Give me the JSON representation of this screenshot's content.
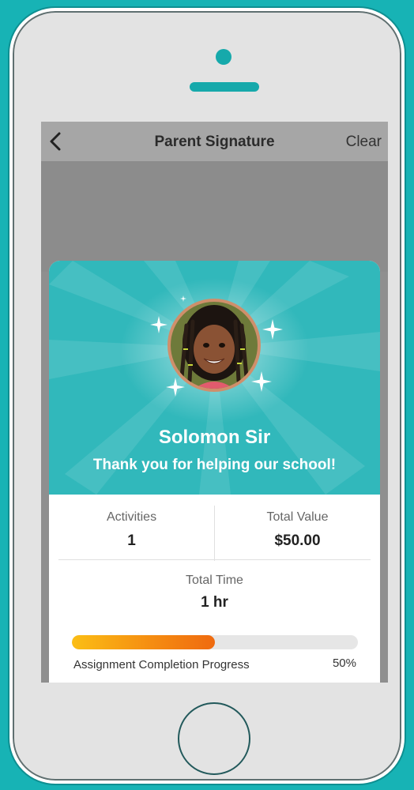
{
  "nav": {
    "title": "Parent Signature",
    "clear_label": "Clear",
    "back_icon": "chevron-left-icon"
  },
  "profile": {
    "name": "Solomon Sir",
    "message": "Thank you for helping our school!"
  },
  "stats": {
    "activities_label": "Activities",
    "activities_value": "1",
    "total_value_label": "Total Value",
    "total_value_value": "$50.00",
    "total_time_label": "Total Time",
    "total_time_value": "1 hr"
  },
  "progress": {
    "label": "Assignment Completion Progress",
    "percent_text": "50%",
    "fraction": 0.5
  },
  "colors": {
    "background": "#17b3b5",
    "card_header": "#31b8bb",
    "progress_start": "#fbbe15",
    "progress_end": "#ef6a0f"
  }
}
